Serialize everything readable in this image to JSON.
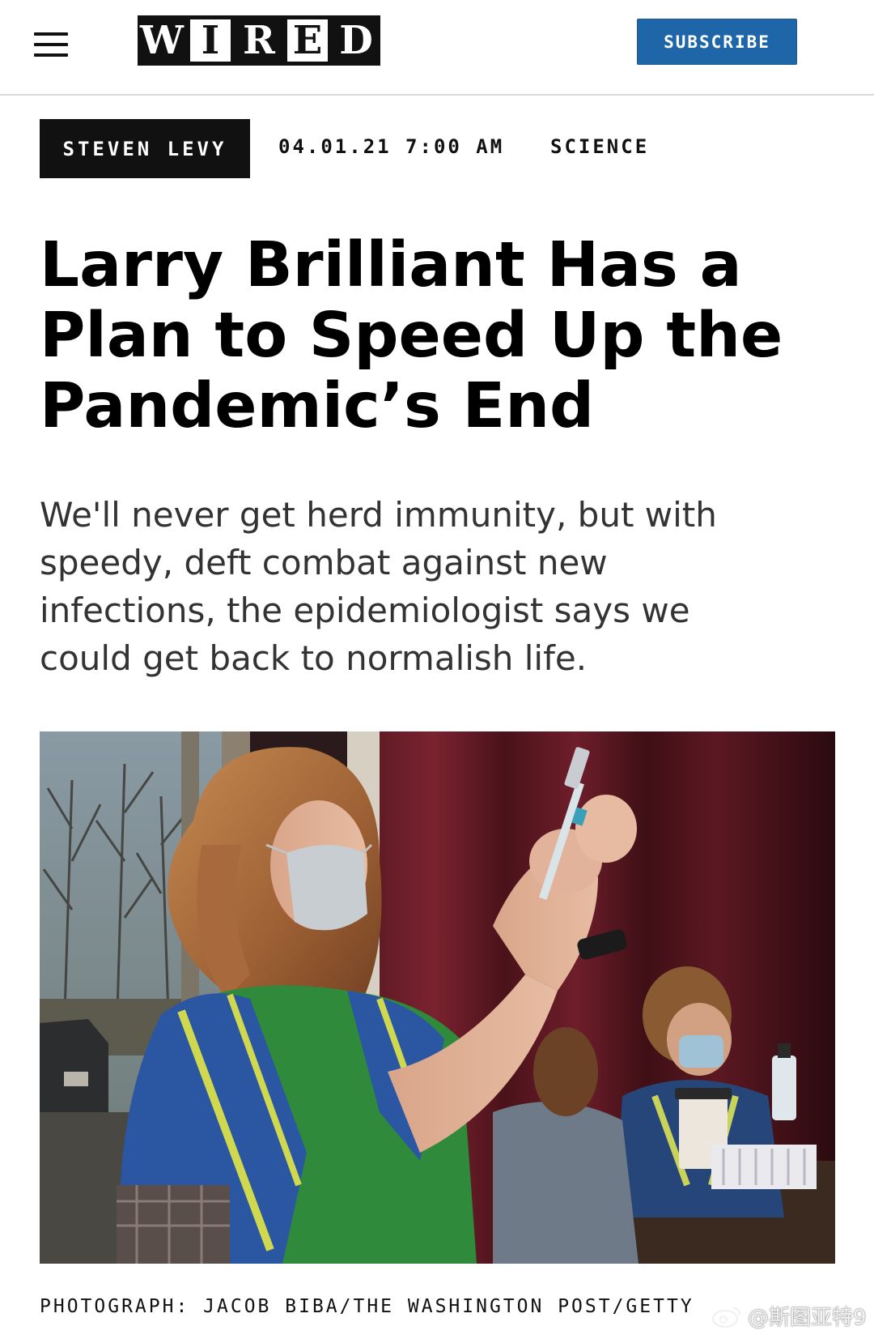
{
  "header": {
    "logo_letters": [
      "W",
      "I",
      "R",
      "E",
      "D"
    ],
    "subscribe_label": "SUBSCRIBE"
  },
  "article": {
    "author": "STEVEN LEVY",
    "date": "04.01.21 7:00 AM",
    "category": "SCIENCE",
    "headline_lines": [
      "Larry Brilliant Has a",
      "Plan to Speed Up the",
      "Pandemic’s End"
    ],
    "dek_lines": [
      "We'll never get herd immunity, but with",
      "speedy, deft combat against new",
      "infections, the epidemiologist says we",
      "could get back to normalish life."
    ],
    "photo_caption": "PHOTOGRAPH: JACOB BIBA/THE WASHINGTON POST/GETTY"
  },
  "watermark": {
    "text": "@斯图亚特9"
  },
  "colors": {
    "subscribe_bg": "#1e66a8",
    "author_bg": "#111111",
    "dek_text": "#333333"
  }
}
